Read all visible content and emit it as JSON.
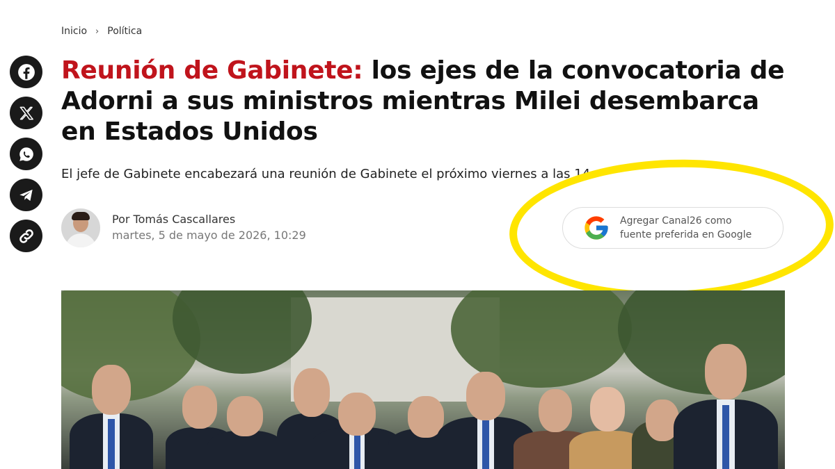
{
  "breadcrumb": {
    "home": "Inicio",
    "separator": "›",
    "section": "Política"
  },
  "share": {
    "icons": [
      "facebook-icon",
      "x-icon",
      "whatsapp-icon",
      "telegram-icon",
      "link-icon"
    ]
  },
  "article": {
    "title_accent": "Reunión de Gabinete:",
    "title_rest": "los ejes de la convocatoria de Adorni a sus ministros mientras Milei desembarca en Estados Unidos",
    "subtitle": "El jefe de Gabinete encabezará una reunión de Gabinete el próximo viernes a las 14.",
    "author": "Por Tomás Cascallares",
    "date": "martes, 5 de mayo de 2026, 10:29"
  },
  "google_pref": {
    "line1": "Agregar Canal26 como",
    "line2": "fuente preferida en Google",
    "icon": "google-logo-icon"
  },
  "colors": {
    "accent": "#c0141c",
    "highlight": "#ffe500",
    "share_bg": "#1a1a1a"
  }
}
